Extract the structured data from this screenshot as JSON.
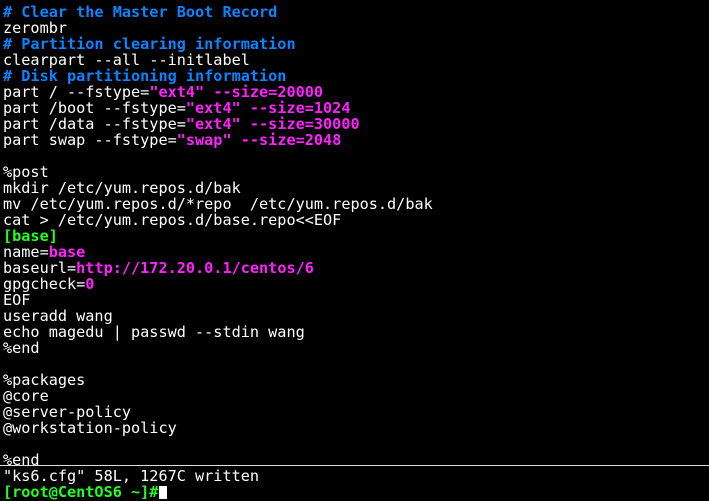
{
  "colors": {
    "background": "#000000",
    "comment": "#0a84ff",
    "string": "#ff22ff",
    "section_header": "#22ff22",
    "text": "#ffffff"
  },
  "editor": {
    "lines": [
      {
        "segments": [
          {
            "text": "# Clear the Master Boot Record",
            "style": "comment"
          }
        ]
      },
      {
        "segments": [
          {
            "text": "zerombr",
            "style": "text"
          }
        ]
      },
      {
        "segments": [
          {
            "text": "# Partition clearing information",
            "style": "comment"
          }
        ]
      },
      {
        "segments": [
          {
            "text": "clearpart --all --initlabel",
            "style": "text"
          }
        ]
      },
      {
        "segments": [
          {
            "text": "# Disk partitioning information",
            "style": "comment"
          }
        ]
      },
      {
        "segments": [
          {
            "text": "part / --fstype=",
            "style": "text"
          },
          {
            "text": "\"ext4\"",
            "style": "string"
          },
          {
            "text": " --size=20000",
            "style": "string"
          }
        ]
      },
      {
        "segments": [
          {
            "text": "part /boot --fstype=",
            "style": "text"
          },
          {
            "text": "\"ext4\"",
            "style": "string"
          },
          {
            "text": " --size=1024",
            "style": "string"
          }
        ]
      },
      {
        "segments": [
          {
            "text": "part /data --fstype=",
            "style": "text"
          },
          {
            "text": "\"ext4\"",
            "style": "string"
          },
          {
            "text": " --size=30000",
            "style": "string"
          }
        ]
      },
      {
        "segments": [
          {
            "text": "part swap --fstype=",
            "style": "text"
          },
          {
            "text": "\"swap\"",
            "style": "string"
          },
          {
            "text": " --size=2048",
            "style": "string"
          }
        ]
      },
      {
        "segments": []
      },
      {
        "segments": [
          {
            "text": "%post",
            "style": "text"
          }
        ]
      },
      {
        "segments": [
          {
            "text": "mkdir /etc/yum.repos.d/bak",
            "style": "text"
          }
        ]
      },
      {
        "segments": [
          {
            "text": "mv /etc/yum.repos.d/*repo  /etc/yum.repos.d/bak",
            "style": "text"
          }
        ]
      },
      {
        "segments": [
          {
            "text": "cat > /etc/yum.repos.d/base.repo<<EOF",
            "style": "text"
          }
        ]
      },
      {
        "segments": [
          {
            "text": "[base]",
            "style": "section_header"
          }
        ]
      },
      {
        "segments": [
          {
            "text": "name=",
            "style": "text"
          },
          {
            "text": "base",
            "style": "string"
          }
        ]
      },
      {
        "segments": [
          {
            "text": "baseurl=",
            "style": "text"
          },
          {
            "text": "http://172.20.0.1/centos/6",
            "style": "string"
          }
        ]
      },
      {
        "segments": [
          {
            "text": "gpgcheck=",
            "style": "text"
          },
          {
            "text": "0",
            "style": "string"
          }
        ]
      },
      {
        "segments": [
          {
            "text": "EOF",
            "style": "text"
          }
        ]
      },
      {
        "segments": [
          {
            "text": "useradd wang",
            "style": "text"
          }
        ]
      },
      {
        "segments": [
          {
            "text": "echo magedu | passwd --stdin wang",
            "style": "text"
          }
        ]
      },
      {
        "segments": [
          {
            "text": "%end",
            "style": "text"
          }
        ]
      },
      {
        "segments": []
      },
      {
        "segments": [
          {
            "text": "%packages",
            "style": "text"
          }
        ]
      },
      {
        "segments": [
          {
            "text": "@core",
            "style": "text"
          }
        ]
      },
      {
        "segments": [
          {
            "text": "@server-policy",
            "style": "text"
          }
        ]
      },
      {
        "segments": [
          {
            "text": "@workstation-policy",
            "style": "text"
          }
        ]
      },
      {
        "segments": []
      },
      {
        "segments": [
          {
            "text": "%end",
            "style": "text"
          }
        ]
      }
    ]
  },
  "status": {
    "message": "\"ks6.cfg\" 58L, 1267C written"
  },
  "prompt": {
    "text": "[root@CentOS6 ~]#"
  }
}
